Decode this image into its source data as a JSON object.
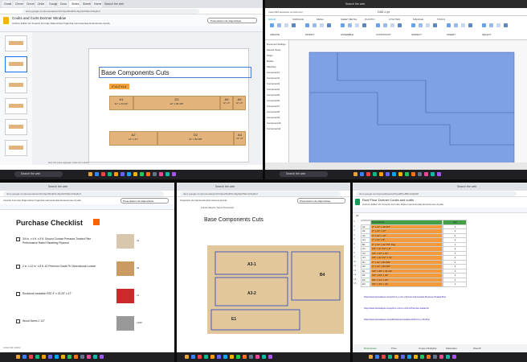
{
  "taskbar": {
    "search_placeholder": "Search the web"
  },
  "slides_window": {
    "tabs": [
      "Gmail",
      "Chrome",
      "Chrome",
      "Drive",
      "Google",
      "Docs",
      "Slides",
      "Sheets",
      "Home"
    ],
    "address": "docs.google.com/presentation/d/1YapwSbd0XeJ3gh4dVNkmlUfsqfwrf",
    "doc_title": "Cooks and Curts Dormer Window",
    "menu": [
      "Archivo",
      "Editar",
      "Ver",
      "Insertar",
      "Formato",
      "Diapositiva",
      "Organizar",
      "Herramientas",
      "Extensiones",
      "Ayuda"
    ],
    "slideshow_button": "Presentación de diapositivas",
    "slide_title": "Base Components Cuts",
    "sheet_label": "2\"x12\"x14'",
    "row1": [
      {
        "label": "A1",
        "dim": "12\" x 20 3/4\""
      },
      {
        "label": "D2",
        "dim": "12\" x 84 3/8\""
      },
      {
        "label": "A5",
        "dim": "12\" x 8\""
      },
      {
        "label": "A5",
        "dim": "12\" x 8\""
      }
    ],
    "row2": [
      {
        "label": "A2",
        "dim": "12\" x 47\""
      },
      {
        "label": "D2",
        "dim": "12\" x 84 3/8\""
      },
      {
        "label": "A4",
        "dim": "12\" x 8\""
      }
    ],
    "notes": "Haz clic para agregar notas del orador",
    "thumb_count": 6
  },
  "cad_window": {
    "address": "fusion360.autodesk.com/dormer",
    "title": "CAD •• pr",
    "ribbon_tabs": [
      "SOLID",
      "SURFACE",
      "MESH",
      "SHEET METAL",
      "PLASTIC",
      "UTILITIES",
      "MANAGE",
      "TOOLS"
    ],
    "ribbon_groups": [
      "CREATE",
      "MODIFY",
      "ASSEMBLE",
      "CONSTRUCT",
      "INSPECT",
      "INSERT",
      "SELECT"
    ],
    "browser_items": [
      "Document Settings",
      "Named Views",
      "Origin",
      "Bodies",
      "Sketches",
      "Component1",
      "Component2",
      "Component3",
      "Component4",
      "Component5",
      "Component6",
      "Component7",
      "Component8",
      "Component9",
      "Component10",
      "Component11"
    ]
  },
  "checklist_window": {
    "address": "docs.google.com/presentation/d/1YapwSbd0XeJ3gh4dVNkmlUfsqfwrf",
    "menu": [
      "Insertar",
      "Formato",
      "Diapositiva",
      "Organizar",
      "Herramientas",
      "Extensiones",
      "Ayuda"
    ],
    "slideshow_button": "Presentación de diapositivas",
    "title": "Purchase Checklist",
    "items": [
      {
        "text": "3/4 in. x 4 ft. x 8 ft. Ground Contact Pressure-Treated Pine Performance Rated Sheathing Plywood",
        "qty": "x2"
      },
      {
        "text": "2 in. x 12 in. x 8 ft. #2 Premium Grade Fir Dimensional Lumber",
        "qty": "x3"
      },
      {
        "text": "Rockwool Insulation R30 3\" x 15.25\" x 47\"",
        "qty": "x1"
      },
      {
        "text": "Wood Screw 2 1/2\"",
        "qty": "x100"
      }
    ],
    "notes": "notas del orador"
  },
  "diagram_window": {
    "address": "docs.google.com/presentation/d/1YapwSbd0XeJ3gh4dVNkmlUfsqfwrf",
    "menu": [
      "Organizar",
      "Herramientas",
      "Extensiones",
      "Ayuda"
    ],
    "toolbar": [
      "Fondo",
      "Diseño",
      "Tema",
      "Transición"
    ],
    "slideshow_button": "Presentación de diapositivas",
    "title": "Base Components Cuts",
    "labels": [
      "A3-1",
      "B4",
      "A3-2",
      "E1"
    ]
  },
  "sheets_window": {
    "address": "docs.google.com/spreadsheets/d/1qa3BzoRBm4dQhkP",
    "title": "Roof Floor Dormer Cooks and curtis",
    "menu": [
      "Archivo",
      "Editar",
      "Ver",
      "Insertar",
      "Formato",
      "Datos",
      "Herramientas",
      "Extensiones",
      "Ayuda"
    ],
    "cell_ref": "A1",
    "header": [
      "",
      "Dimensions",
      "Qty"
    ],
    "rows": [
      [
        "A1",
        "2\" x 12\" x 20 3/4\"",
        "2"
      ],
      [
        "A2",
        "2\" x 12\" x 47\"",
        "2"
      ],
      [
        "A3",
        "2\" x 12\" x 12\"",
        "2"
      ],
      [
        "A4",
        "2\" x 12\" x 8\"",
        "2"
      ],
      [
        "B1",
        "2\" x 12\" x 42 7/8\" Deg",
        "1"
      ],
      [
        "C1",
        "3/4\" x 47 1/2\" x 8\"",
        "2"
      ],
      [
        "C2",
        "3/4\" x 47\" x 16\"",
        "1"
      ],
      [
        "C3",
        "3/4\" x 42 1/2\" x 13\"",
        "1"
      ],
      [
        "D1",
        "2\" x 12\" x 84 3/8\"",
        "2"
      ],
      [
        "D2",
        "2\" x 12\" x 84 3/8\"",
        "2"
      ],
      [
        "E1",
        "3/4\" x 48\" x 42 1/2\"",
        "1"
      ],
      [
        "E2",
        "3/4\" x 84\" x 42\"",
        "1"
      ],
      [
        "E3",
        "3/4\" x 12\" x 20\"",
        "1"
      ],
      [
        "E4",
        "3/4\" x 16\" x 42\"",
        "1"
      ]
    ],
    "links": [
      "https://www.homedepot.com/p/3-4-in-x-4-ft-x-8-ft-Ground-Contact-Pressure-Treated-Pine",
      "https://www.homedepot.com/p/2-in-x-12-in-x-8-ft-2-Premium-Grade-Fir",
      "https://www.homedepot.com/p/Rockwool-Insulation-R30-3-in-x-15-25-in"
    ],
    "sheet_tabs": [
      "Dimensions",
      "Price",
      "Cooper Multiplier",
      "Materiales",
      "Sheet5"
    ]
  }
}
